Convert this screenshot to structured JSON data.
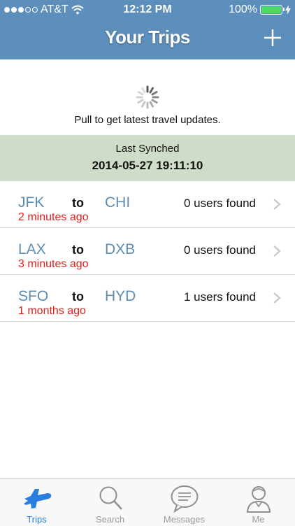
{
  "status_bar": {
    "carrier": "AT&T",
    "time": "12:12 PM",
    "battery": "100%"
  },
  "header": {
    "title": "Your Trips",
    "add_icon": "plus-icon",
    "background_color": "#5c8fbc"
  },
  "refresh": {
    "spinner_icon": "spinner-icon",
    "text": "Pull to get latest travel updates."
  },
  "sync": {
    "label": "Last Synched",
    "value": "2014-05-27 19:11:10",
    "background_color": "#cfdcc7"
  },
  "trips": [
    {
      "from": "JFK",
      "to_word": "to",
      "to": "CHI",
      "users": "0 users found",
      "ago": "2 minutes ago"
    },
    {
      "from": "LAX",
      "to_word": "to",
      "to": "DXB",
      "users": "0 users found",
      "ago": "3 minutes ago"
    },
    {
      "from": "SFO",
      "to_word": "to",
      "to": "HYD",
      "users": "1 users found",
      "ago": "1 months ago"
    }
  ],
  "tabbar": {
    "tabs": [
      {
        "label": "Trips",
        "icon": "airplane-icon",
        "active": true
      },
      {
        "label": "Search",
        "icon": "search-icon",
        "active": false
      },
      {
        "label": "Messages",
        "icon": "chat-bubble-icon",
        "active": false
      },
      {
        "label": "Me",
        "icon": "person-icon",
        "active": false
      }
    ]
  },
  "colors": {
    "accent": "#2a7ee0",
    "airport_code": "#5b8db5",
    "time_ago": "#e2201c"
  }
}
